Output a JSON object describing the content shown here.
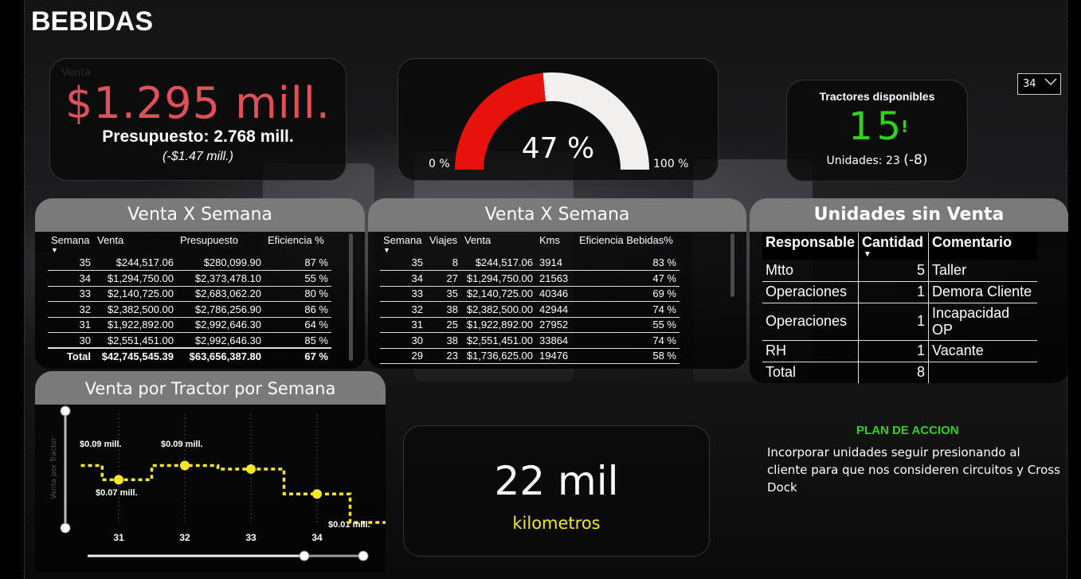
{
  "page": {
    "title": "BEBIDAS"
  },
  "kpi_venta": {
    "ghost_label": "Venta",
    "value": "$1.295 mill.",
    "budget": "Presupuesto: 2.768 mill.",
    "difference": "(-$1.47 mill.)"
  },
  "gauge": {
    "value_text": "47 %",
    "value": 47,
    "min_label": "0 %",
    "max_label": "100 %",
    "fill_color": "#e8120c",
    "track_color": "#f2f0ef"
  },
  "tractores": {
    "label": "Tractores disponibles",
    "value": "15",
    "flag": "!",
    "units_prefix": "Unidades: ",
    "units_value": "23",
    "units_delta": "(-8)"
  },
  "week_slicer": {
    "selected": "34"
  },
  "venta_semana_1": {
    "title": "Venta X Semana",
    "headers": [
      "Semana",
      "Venta",
      "Presupuesto",
      "Eficiencia %"
    ],
    "rows": [
      [
        "35",
        "$244,517.06",
        "$280,099.90",
        "87 %"
      ],
      [
        "34",
        "$1,294,750.00",
        "$2,373,478.10",
        "55 %"
      ],
      [
        "33",
        "$2,140,725.00",
        "$2,683,062.20",
        "80 %"
      ],
      [
        "32",
        "$2,382,500.00",
        "$2,786,256.90",
        "86 %"
      ],
      [
        "31",
        "$1,922,892.00",
        "$2,992,646.30",
        "64 %"
      ],
      [
        "30",
        "$2,551,451.00",
        "$2,992,646.30",
        "85 %"
      ]
    ],
    "total": [
      "Total",
      "$42,745,545.39",
      "$63,656,387.80",
      "67 %"
    ]
  },
  "venta_semana_2": {
    "title": "Venta X Semana",
    "headers": [
      "Semana",
      "Viajes",
      "Venta",
      "Kms",
      "Eficiencia Bebidas%"
    ],
    "rows": [
      [
        "35",
        "8",
        "$244,517.06",
        "3914",
        "83 %"
      ],
      [
        "34",
        "27",
        "$1,294,750.00",
        "21563",
        "47 %"
      ],
      [
        "33",
        "35",
        "$2,140,725.00",
        "40346",
        "69 %"
      ],
      [
        "32",
        "38",
        "$2,382,500.00",
        "42944",
        "74 %"
      ],
      [
        "31",
        "25",
        "$1,922,892.00",
        "27952",
        "55 %"
      ],
      [
        "30",
        "38",
        "$2,551,451.00",
        "33864",
        "74 %"
      ],
      [
        "29",
        "23",
        "$1,736,625.00",
        "19476",
        "58 %"
      ]
    ]
  },
  "unidades_sin_venta": {
    "title": "Unidades sin Venta",
    "headers": [
      "Responsable",
      "Cantidad",
      "Comentario"
    ],
    "rows": [
      [
        "Mtto",
        "5",
        "Taller"
      ],
      [
        "Operaciones",
        "1",
        "Demora Cliente"
      ],
      [
        "Operaciones",
        "1",
        "Incapacidad OP"
      ],
      [
        "RH",
        "1",
        "Vacante"
      ]
    ],
    "total": [
      "Total",
      "8",
      ""
    ]
  },
  "tractor_chart": {
    "title": "Venta por Tractor por Semana"
  },
  "chart_data": {
    "type": "line",
    "title": "Venta por Tractor por Semana",
    "ylabel": "Venta por Tractor",
    "x_ticks": [
      "31",
      "32",
      "33",
      "34"
    ],
    "points": [
      {
        "x": 30.5,
        "y": 0.09,
        "label": "$0.09 mill."
      },
      {
        "x": 31,
        "y": 0.07,
        "label": "$0.07 mill."
      },
      {
        "x": 32,
        "y": 0.09,
        "label": "$0.09 mill."
      },
      {
        "x": 33,
        "y": 0.085,
        "label": ""
      },
      {
        "x": 34,
        "y": 0.05,
        "label": ""
      },
      {
        "x": 35,
        "y": 0.01,
        "label": "$0.01 mill."
      }
    ],
    "line_color": "#f5e52b",
    "style": "dashed step"
  },
  "kilometros": {
    "value": "22 mil",
    "unit": "kilometros"
  },
  "plan": {
    "title": "PLAN DE ACCION",
    "text": "Incorporar unidades seguir presionando al cliente para que nos consideren circuitos y Cross Dock"
  }
}
